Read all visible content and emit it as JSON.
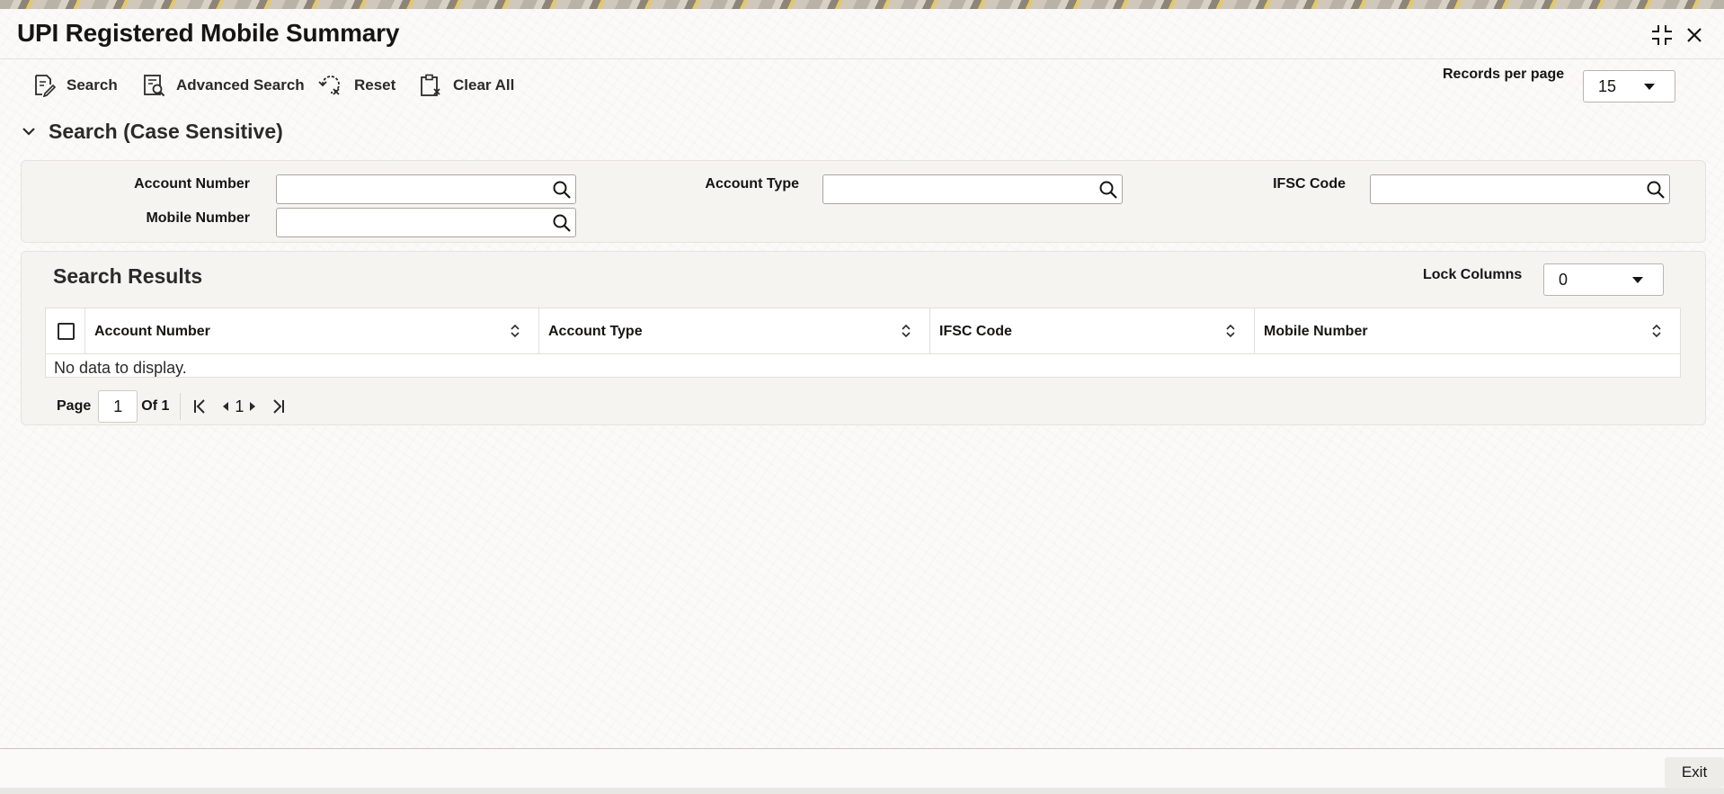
{
  "window": {
    "title": "UPI Registered Mobile Summary"
  },
  "toolbar": {
    "search_label": "Search",
    "advanced_search_label": "Advanced Search",
    "reset_label": "Reset",
    "clear_all_label": "Clear All",
    "records_per_page_label": "Records per page",
    "records_per_page_value": "15"
  },
  "search_section": {
    "title": "Search (Case Sensitive)",
    "fields": {
      "account_number": {
        "label": "Account Number",
        "value": ""
      },
      "account_type": {
        "label": "Account Type",
        "value": ""
      },
      "ifsc_code": {
        "label": "IFSC Code",
        "value": ""
      },
      "mobile_number": {
        "label": "Mobile Number",
        "value": ""
      }
    }
  },
  "results": {
    "title": "Search Results",
    "lock_columns_label": "Lock Columns",
    "lock_columns_value": "0",
    "columns": [
      "Account Number",
      "Account Type",
      "IFSC Code",
      "Mobile Number"
    ],
    "rows": [],
    "empty_message": "No data to display."
  },
  "pagination": {
    "page_label": "Page",
    "current_page": "1",
    "of_label": "Of 1",
    "page_number": "1"
  },
  "footer": {
    "exit_label": "Exit"
  },
  "icons": {
    "search": "search-doc-icon",
    "advanced_search": "advanced-search-icon",
    "reset": "reset-icon",
    "clear_all": "clipboard-clear-icon",
    "lookup": "magnifier-icon",
    "collapse": "chevron-down-icon",
    "sort": "sort-arrows-icon",
    "minimize": "collapse-window-icon",
    "close": "close-icon"
  }
}
